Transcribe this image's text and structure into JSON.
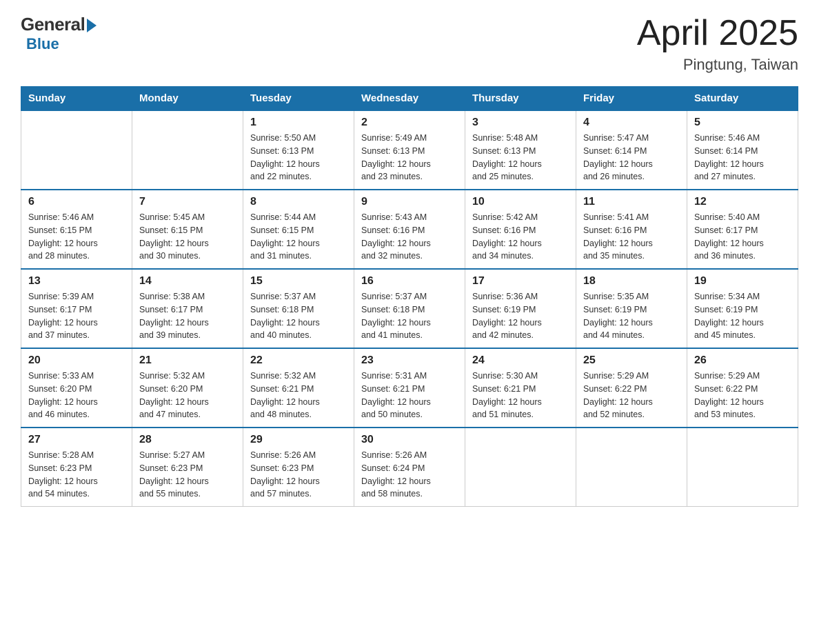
{
  "logo": {
    "general": "General",
    "blue": "Blue"
  },
  "title": {
    "month": "April 2025",
    "location": "Pingtung, Taiwan"
  },
  "weekdays": [
    "Sunday",
    "Monday",
    "Tuesday",
    "Wednesday",
    "Thursday",
    "Friday",
    "Saturday"
  ],
  "weeks": [
    [
      {
        "day": "",
        "info": ""
      },
      {
        "day": "",
        "info": ""
      },
      {
        "day": "1",
        "info": "Sunrise: 5:50 AM\nSunset: 6:13 PM\nDaylight: 12 hours\nand 22 minutes."
      },
      {
        "day": "2",
        "info": "Sunrise: 5:49 AM\nSunset: 6:13 PM\nDaylight: 12 hours\nand 23 minutes."
      },
      {
        "day": "3",
        "info": "Sunrise: 5:48 AM\nSunset: 6:13 PM\nDaylight: 12 hours\nand 25 minutes."
      },
      {
        "day": "4",
        "info": "Sunrise: 5:47 AM\nSunset: 6:14 PM\nDaylight: 12 hours\nand 26 minutes."
      },
      {
        "day": "5",
        "info": "Sunrise: 5:46 AM\nSunset: 6:14 PM\nDaylight: 12 hours\nand 27 minutes."
      }
    ],
    [
      {
        "day": "6",
        "info": "Sunrise: 5:46 AM\nSunset: 6:15 PM\nDaylight: 12 hours\nand 28 minutes."
      },
      {
        "day": "7",
        "info": "Sunrise: 5:45 AM\nSunset: 6:15 PM\nDaylight: 12 hours\nand 30 minutes."
      },
      {
        "day": "8",
        "info": "Sunrise: 5:44 AM\nSunset: 6:15 PM\nDaylight: 12 hours\nand 31 minutes."
      },
      {
        "day": "9",
        "info": "Sunrise: 5:43 AM\nSunset: 6:16 PM\nDaylight: 12 hours\nand 32 minutes."
      },
      {
        "day": "10",
        "info": "Sunrise: 5:42 AM\nSunset: 6:16 PM\nDaylight: 12 hours\nand 34 minutes."
      },
      {
        "day": "11",
        "info": "Sunrise: 5:41 AM\nSunset: 6:16 PM\nDaylight: 12 hours\nand 35 minutes."
      },
      {
        "day": "12",
        "info": "Sunrise: 5:40 AM\nSunset: 6:17 PM\nDaylight: 12 hours\nand 36 minutes."
      }
    ],
    [
      {
        "day": "13",
        "info": "Sunrise: 5:39 AM\nSunset: 6:17 PM\nDaylight: 12 hours\nand 37 minutes."
      },
      {
        "day": "14",
        "info": "Sunrise: 5:38 AM\nSunset: 6:17 PM\nDaylight: 12 hours\nand 39 minutes."
      },
      {
        "day": "15",
        "info": "Sunrise: 5:37 AM\nSunset: 6:18 PM\nDaylight: 12 hours\nand 40 minutes."
      },
      {
        "day": "16",
        "info": "Sunrise: 5:37 AM\nSunset: 6:18 PM\nDaylight: 12 hours\nand 41 minutes."
      },
      {
        "day": "17",
        "info": "Sunrise: 5:36 AM\nSunset: 6:19 PM\nDaylight: 12 hours\nand 42 minutes."
      },
      {
        "day": "18",
        "info": "Sunrise: 5:35 AM\nSunset: 6:19 PM\nDaylight: 12 hours\nand 44 minutes."
      },
      {
        "day": "19",
        "info": "Sunrise: 5:34 AM\nSunset: 6:19 PM\nDaylight: 12 hours\nand 45 minutes."
      }
    ],
    [
      {
        "day": "20",
        "info": "Sunrise: 5:33 AM\nSunset: 6:20 PM\nDaylight: 12 hours\nand 46 minutes."
      },
      {
        "day": "21",
        "info": "Sunrise: 5:32 AM\nSunset: 6:20 PM\nDaylight: 12 hours\nand 47 minutes."
      },
      {
        "day": "22",
        "info": "Sunrise: 5:32 AM\nSunset: 6:21 PM\nDaylight: 12 hours\nand 48 minutes."
      },
      {
        "day": "23",
        "info": "Sunrise: 5:31 AM\nSunset: 6:21 PM\nDaylight: 12 hours\nand 50 minutes."
      },
      {
        "day": "24",
        "info": "Sunrise: 5:30 AM\nSunset: 6:21 PM\nDaylight: 12 hours\nand 51 minutes."
      },
      {
        "day": "25",
        "info": "Sunrise: 5:29 AM\nSunset: 6:22 PM\nDaylight: 12 hours\nand 52 minutes."
      },
      {
        "day": "26",
        "info": "Sunrise: 5:29 AM\nSunset: 6:22 PM\nDaylight: 12 hours\nand 53 minutes."
      }
    ],
    [
      {
        "day": "27",
        "info": "Sunrise: 5:28 AM\nSunset: 6:23 PM\nDaylight: 12 hours\nand 54 minutes."
      },
      {
        "day": "28",
        "info": "Sunrise: 5:27 AM\nSunset: 6:23 PM\nDaylight: 12 hours\nand 55 minutes."
      },
      {
        "day": "29",
        "info": "Sunrise: 5:26 AM\nSunset: 6:23 PM\nDaylight: 12 hours\nand 57 minutes."
      },
      {
        "day": "30",
        "info": "Sunrise: 5:26 AM\nSunset: 6:24 PM\nDaylight: 12 hours\nand 58 minutes."
      },
      {
        "day": "",
        "info": ""
      },
      {
        "day": "",
        "info": ""
      },
      {
        "day": "",
        "info": ""
      }
    ]
  ]
}
